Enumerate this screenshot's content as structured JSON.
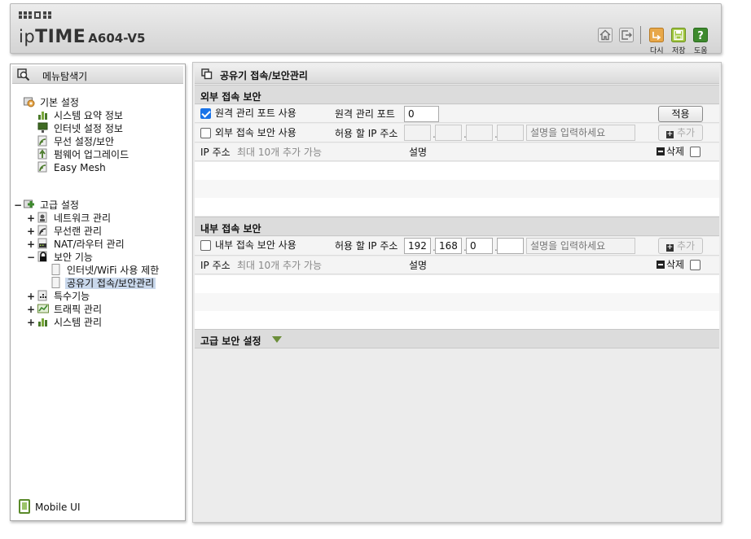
{
  "header": {
    "brand_ip": "ip",
    "brand_time": "TIME",
    "model": "A604-V5",
    "buttons": {
      "home_icon": "home-icon",
      "logout_icon": "logout-icon",
      "reload_label": "다시",
      "save_label": "저장",
      "help_label": "도움",
      "help_glyph": "?"
    },
    "colors": {
      "reload": "#e8a84a",
      "save": "#9ec43c",
      "help": "#3e8a2e"
    }
  },
  "sidebar": {
    "title": "메뉴탐색기",
    "basic": {
      "label": "기본 설정",
      "items": [
        "시스템 요약 정보",
        "인터넷 설정 정보",
        "무선 설정/보안",
        "펌웨어 업그레이드",
        "Easy Mesh"
      ]
    },
    "advanced": {
      "toggle": "−",
      "label": "고급 설정",
      "items": [
        {
          "toggle": "+",
          "label": "네트워크 관리"
        },
        {
          "toggle": "+",
          "label": "무선랜 관리"
        },
        {
          "toggle": "+",
          "label": "NAT/라우터 관리"
        },
        {
          "toggle": "−",
          "label": "보안 기능"
        },
        {
          "toggle": "+",
          "label": "특수기능"
        },
        {
          "toggle": "+",
          "label": "트래픽 관리"
        },
        {
          "toggle": "+",
          "label": "시스템 관리"
        }
      ],
      "security_children": [
        "인터넷/WiFi 사용 제한",
        "공유기 접속/보안관리"
      ]
    },
    "mobile_ui": "Mobile UI"
  },
  "main": {
    "title": "공유기 접속/보안관리",
    "external": {
      "title": "외부 접속 보안",
      "remote_port_checkbox_label": "원격 관리 포트 사용",
      "remote_port_checked": true,
      "remote_port_label": "원격 관리 포트",
      "remote_port_value": "0",
      "apply_label": "적용",
      "ext_security_label": "외부 접속 보안 사용",
      "ext_security_checked": false,
      "allowed_ip_label": "허용 할 IP 주소",
      "ip": [
        "",
        "",
        "",
        ""
      ],
      "desc_placeholder": "설명을 입력하세요",
      "add_label": "추가",
      "table": {
        "ip_header": "IP 주소",
        "max_note": "최대 10개 추가 가능",
        "desc_header": "설명",
        "delete_label": "삭제"
      }
    },
    "internal": {
      "title": "내부 접속 보안",
      "int_security_label": "내부 접속 보안 사용",
      "int_security_checked": false,
      "allowed_ip_label": "허용 할 IP 주소",
      "ip": [
        "192",
        "168",
        "0",
        ""
      ],
      "desc_placeholder": "설명을 입력하세요",
      "add_label": "추가",
      "table": {
        "ip_header": "IP 주소",
        "max_note": "최대 10개 추가 가능",
        "desc_header": "설명",
        "delete_label": "삭제"
      }
    },
    "advanced_security": {
      "title": "고급 보안 설정",
      "expand_icon": "triangle-down-icon"
    }
  }
}
